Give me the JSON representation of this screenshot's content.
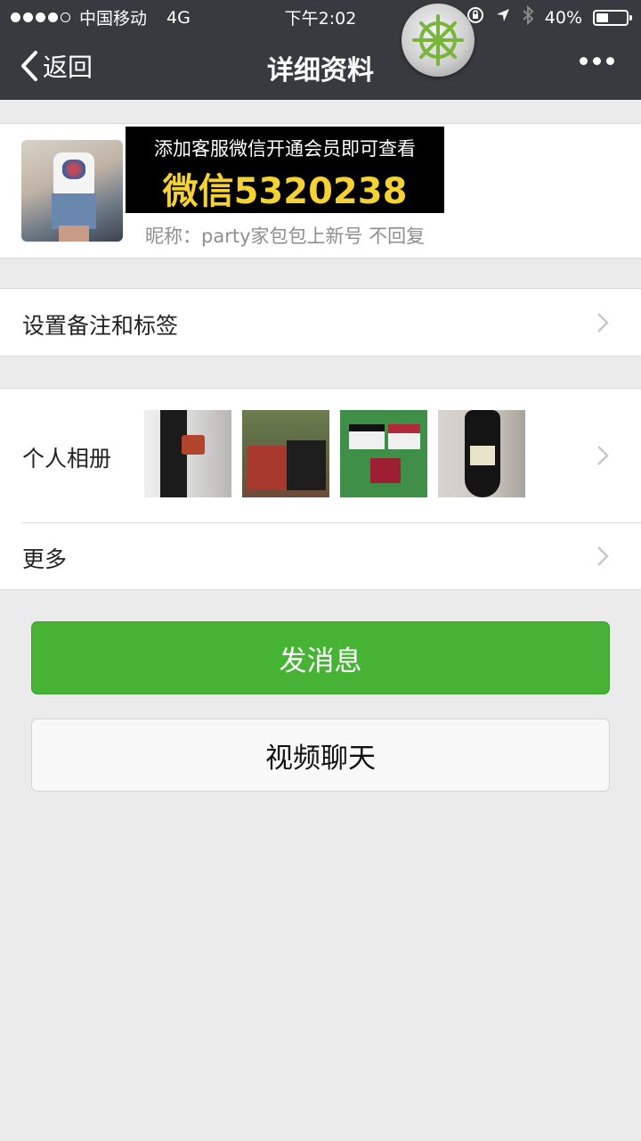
{
  "status_bar": {
    "carrier": "中国移动",
    "network": "4G",
    "time": "下午2:02",
    "battery_text": "40%",
    "battery_level": 0.4
  },
  "nav": {
    "back_label": "返回",
    "title": "详细资料"
  },
  "profile": {
    "ad_line1": "添加客服微信开通会员即可查看",
    "ad_line2": "微信5320238",
    "nickname": "昵称：party家包包上新号 不回复"
  },
  "cells": {
    "remark_label": "设置备注和标签",
    "album_label": "个人相册",
    "more_label": "更多"
  },
  "buttons": {
    "message": "发消息",
    "video_chat": "视频聊天"
  },
  "colors": {
    "nav_bg": "#393a3f",
    "primary_green": "#46b335",
    "ad_yellow": "#f5d132"
  }
}
